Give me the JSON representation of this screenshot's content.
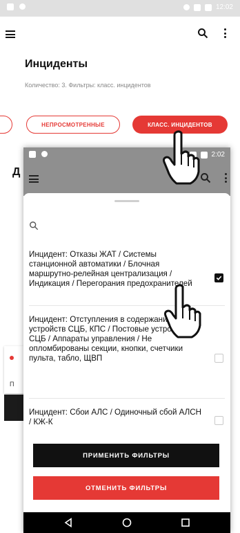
{
  "back_screen": {
    "time": "12:02",
    "title": "Инциденты",
    "subtitle": "Количество: 3.  Фильтры: класс. инцидентов",
    "chip_unviewed": "НЕПРОСМОТРЕННЫЕ",
    "chip_class": "КЛАСС. ИНЦИДЕНТОВ",
    "obscured_title": "Д",
    "card_letter": "П"
  },
  "front_screen": {
    "time": "2:02",
    "items": [
      {
        "text": "Инцидент: Отказы ЖАТ / Системы станционной автоматики / Блочная маршрутно-релейная централизация / Индикация / Перегорания предохранителей",
        "checked": true
      },
      {
        "text": "Инцидент: Отступления в содержании устройств СЦБ, КПС / Постовые устройства СЦБ / Аппараты управления / Не опломбированы секции, кнопки, счетчики пульта, табло, ЩВП",
        "checked": false
      },
      {
        "text": "Инцидент: Сбои АЛС / Одиночный сбой АЛСН / КЖ-К",
        "checked": false
      }
    ],
    "apply_label": "ПРИМЕНИТЬ ФИЛЬТРЫ",
    "cancel_label": "ОТМЕНИТЬ ФИЛЬТРЫ"
  },
  "colors": {
    "accent": "#e53935",
    "dark": "#111111"
  },
  "icons": [
    "menu-icon",
    "search-icon",
    "more-vert-icon",
    "checkmark-icon",
    "back-nav-icon",
    "home-nav-icon",
    "recents-nav-icon",
    "pointing-hand-icon"
  ]
}
